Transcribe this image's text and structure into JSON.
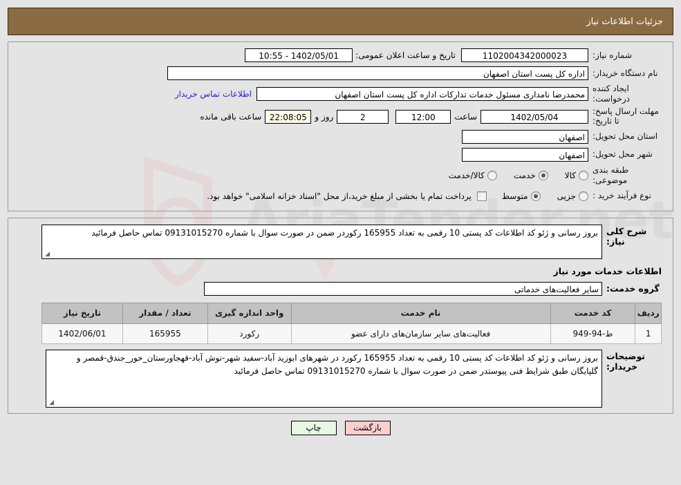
{
  "header": {
    "title": "جزئیات اطلاعات نیاز"
  },
  "form": {
    "need_number_label": "شماره نیاز:",
    "need_number_value": "1102004342000023",
    "announce_label": "تاریخ و ساعت اعلان عمومی:",
    "announce_value": "1402/05/01 - 10:55",
    "buyer_org_label": "نام دستگاه خریدار:",
    "buyer_org_value": "اداره کل پست استان اصفهان",
    "creator_label": "ایجاد کننده درخواست:",
    "creator_value": "محمدرضا نامداری مسئول خدمات تدارکات اداره کل پست استان اصفهان",
    "contact_link": "اطلاعات تماس خریدار",
    "deadline_label": "مهلت ارسال پاسخ: تا تاریخ:",
    "deadline_date": "1402/05/04",
    "deadline_hour_label": "ساعت",
    "deadline_hour_value": "12:00",
    "remaining_days": "2",
    "remaining_days_label": "روز و",
    "remaining_clock": "22:08:05",
    "remaining_suffix_label": "ساعت باقی مانده",
    "province_label": "استان محل تحویل:",
    "province_value": "اصفهان",
    "city_label": "شهر محل تحویل:",
    "city_value": "اصفهان",
    "category_label": "طبقه بندی موضوعی:",
    "category_options": [
      {
        "label": "کالا",
        "selected": false
      },
      {
        "label": "خدمت",
        "selected": true
      },
      {
        "label": "کالا/خدمت",
        "selected": false
      }
    ],
    "process_label": "نوع فرآیند خرید :",
    "process_options": [
      {
        "label": "جزیی",
        "selected": false
      },
      {
        "label": "متوسط",
        "selected": true
      }
    ],
    "payment_checkbox_checked": false,
    "payment_note": "پرداخت تمام یا بخشی از مبلغ خرید،از محل \"اسناد خزانه اسلامی\" خواهد بود."
  },
  "description": {
    "need_summary_label": "شرح کلی نیاز:",
    "need_summary_value": "بروز رسانی و ژئو کد اطلاعات کد پستی 10 رقمی به تعداد 165955 رکوردر ضمن در صورت سوال با شماره 09131015270 تماس حاصل فرمائید",
    "section_title": "اطلاعات خدمات مورد نیاز",
    "service_group_label": "گروه خدمت:",
    "service_group_value": "سایر فعالیت‌های خدماتی"
  },
  "table": {
    "columns": [
      "ردیف",
      "کد خدمت",
      "نام خدمت",
      "واحد اندازه گیری",
      "تعداد / مقدار",
      "تاریخ نیاز"
    ],
    "rows": [
      {
        "index": "1",
        "code": "ط-94-949",
        "name": "فعالیت‌های سایر سازمان‌های دارای عضو",
        "unit": "رکورد",
        "quantity": "165955",
        "date": "1402/06/01"
      }
    ]
  },
  "notes": {
    "label": "توضیحات خریدار:",
    "value": "بروز رسانی و ژئو کد اطلاعات کد پستی 10 رقمی به تعداد 165955 رکورد در شهرهای ابوزید آباد-سفید شهر-نوش آباد-قهجاورستان_خور_جندق-قمصر و گلپایگان طبق شرایط فنی پیوستدر ضمن در صورت سوال با شماره 09131015270 تماس حاصل فرمائید"
  },
  "buttons": {
    "back": "بازگشت",
    "print": "چاپ"
  },
  "colors": {
    "header_bg": "#8b6b43",
    "page_bg": "#e4e4e4",
    "link": "#2323dd",
    "countdown_bg": "#ffffe8",
    "back_btn_bg": "#fbcfcf",
    "print_btn_bg": "#e6f7e2",
    "table_header_bg": "#c2c2c2"
  }
}
